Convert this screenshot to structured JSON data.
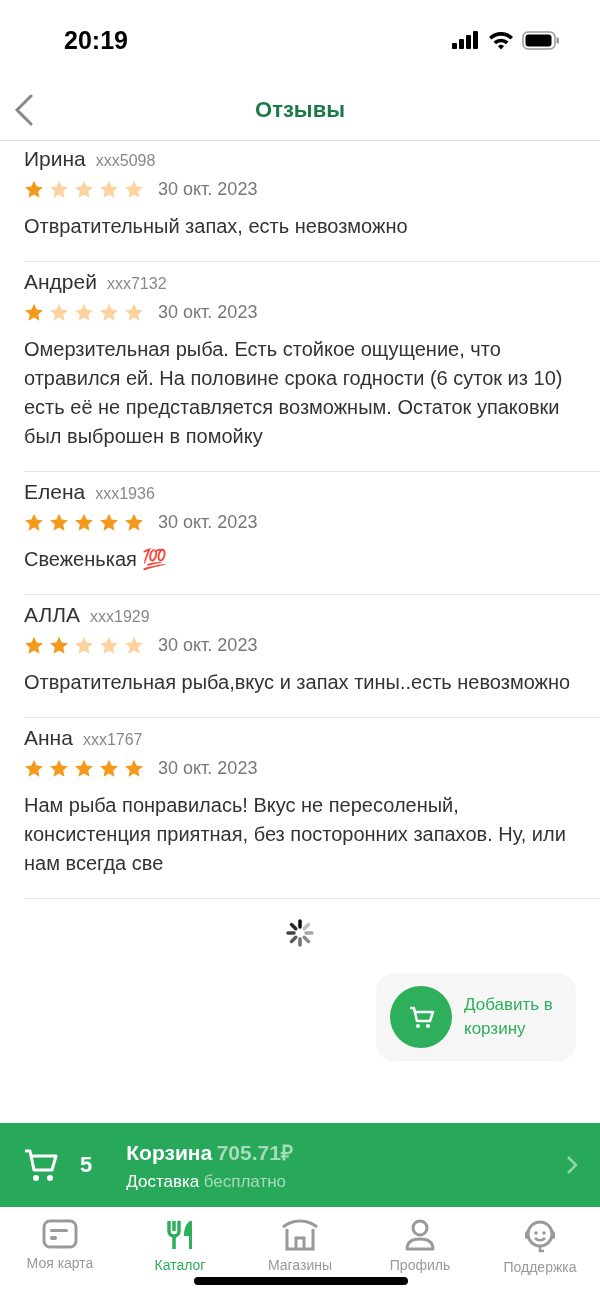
{
  "status_bar": {
    "time": "20:19"
  },
  "header": {
    "title": "Отзывы"
  },
  "reviews": [
    {
      "name": "Ирина",
      "user": "xxx5098",
      "stars": 1,
      "date": "30 окт. 2023",
      "text": "Отвратительный запах, есть невозможно"
    },
    {
      "name": "Андрей",
      "user": "xxx7132",
      "stars": 1,
      "date": "30 окт. 2023",
      "text": "Омерзительная рыба. Есть стойкое ощущение, что отравился ей. На половине срока годности (6 суток из 10) есть её не представляется возможным. Остаток упаковки был выброшен в помойку"
    },
    {
      "name": "Елена",
      "user": "xxx1936",
      "stars": 5,
      "date": "30 окт. 2023",
      "text": "Свеженькая 💯"
    },
    {
      "name": "АЛЛА",
      "user": "xxx1929",
      "stars": 2,
      "date": "30 окт. 2023",
      "text": "Отвратительная рыба,вкус и запах тины..есть невозможно"
    },
    {
      "name": "Анна",
      "user": "xxx1767",
      "stars": 5,
      "date": "30 окт. 2023",
      "text": "Нам рыба понравилась! Вкус не пересоленый, консистенция приятная, без посторонних запахов. Ну, или нам всегда све"
    }
  ],
  "add_to_cart": {
    "label": "Добавить в корзину"
  },
  "cart_bar": {
    "count": "5",
    "title": "Корзина",
    "price": "705.71₽",
    "delivery": "Доставка",
    "delivery_price": "бесплатно"
  },
  "tab_bar": [
    {
      "label": "Моя карта",
      "selected": false
    },
    {
      "label": "Каталог",
      "selected": true
    },
    {
      "label": "Магазины",
      "selected": false
    },
    {
      "label": "Профиль",
      "selected": false
    },
    {
      "label": "Поддержка",
      "selected": false
    }
  ]
}
